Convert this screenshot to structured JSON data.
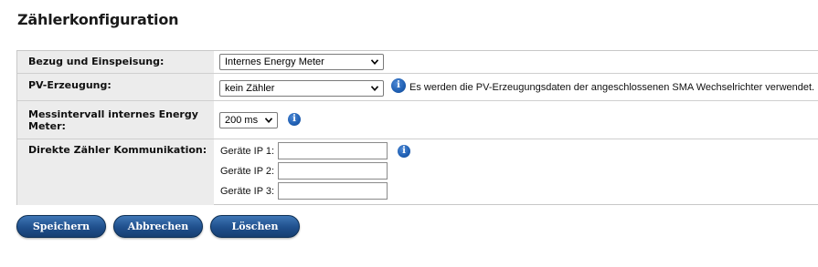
{
  "page": {
    "title": "Zählerkonfiguration"
  },
  "rows": {
    "bezug": {
      "label": "Bezug und Einspeisung:",
      "selected": "Internes Energy Meter"
    },
    "pv": {
      "label": "PV-Erzeugung:",
      "selected": "kein Zähler",
      "hint": "Es werden die PV-Erzeugungsdaten der angeschlossenen SMA Wechselrichter verwendet."
    },
    "messintervall": {
      "label_line1": "Messintervall internes Energy",
      "label_line2": "Meter:",
      "selected": "200 ms"
    },
    "direkt": {
      "label": "Direkte Zähler Kommunikation:",
      "ip1_label": "Geräte IP 1:",
      "ip1_value": "",
      "ip2_label": "Geräte IP 2:",
      "ip2_value": "",
      "ip3_label": "Geräte IP 3:",
      "ip3_value": ""
    }
  },
  "buttons": {
    "save": "Speichern",
    "cancel": "Abbrechen",
    "delete": "Löschen"
  },
  "icons": {
    "info": "info-icon",
    "dropdown": "chevron-down-icon"
  },
  "colors": {
    "button": "#1f4f8c",
    "label_bg": "#ececec",
    "info": "#1f5fb3"
  }
}
